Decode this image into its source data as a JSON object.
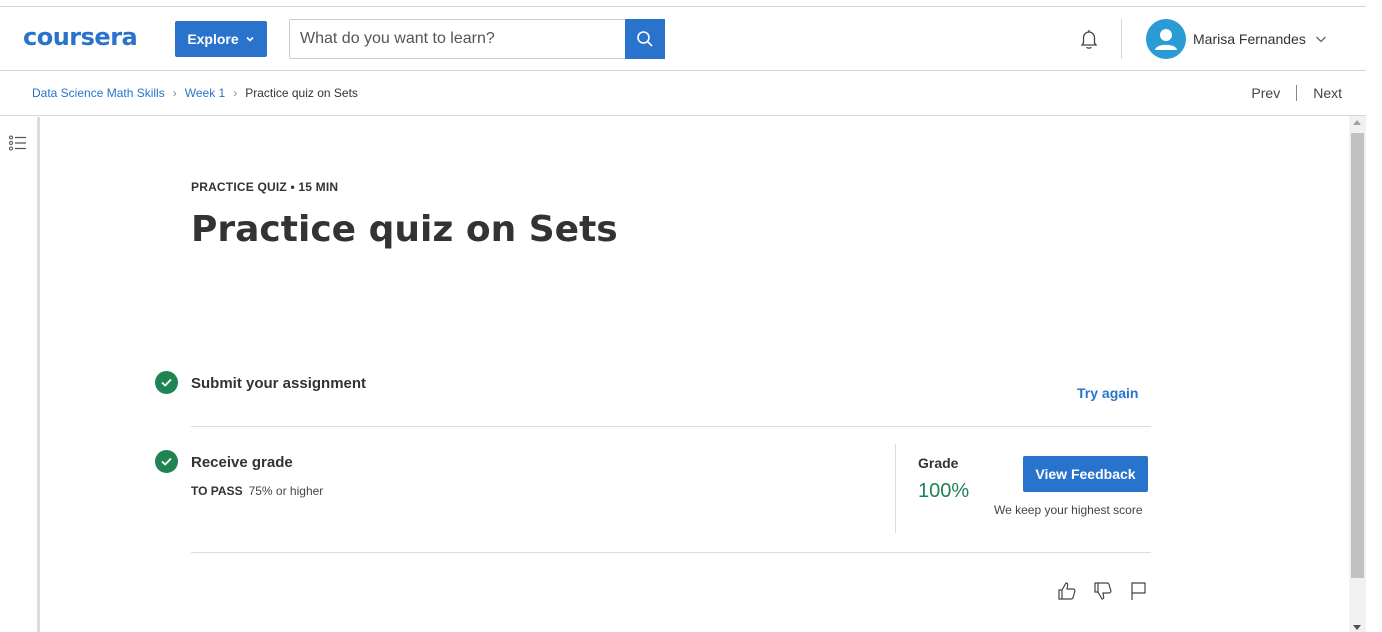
{
  "header": {
    "logo": "coursera",
    "explore_label": "Explore",
    "search_placeholder": "What do you want to learn?",
    "user_name": "Marisa Fernandes",
    "icons": [
      "search-icon",
      "bell-icon",
      "avatar-icon",
      "chevron-down-icon"
    ]
  },
  "breadcrumb": {
    "items": [
      "Data Science Math Skills",
      "Week 1",
      "Practice quiz on Sets"
    ],
    "prev": "Prev",
    "next": "Next"
  },
  "quiz": {
    "kicker": "PRACTICE QUIZ • 15 MIN",
    "title": "Practice quiz on Sets",
    "step1_title": "Submit your assignment",
    "try_again": "Try again",
    "step2_title": "Receive grade",
    "to_pass_label": "TO PASS",
    "to_pass_value": "75% or higher",
    "grade_label": "Grade",
    "grade_value": "100%",
    "view_feedback": "View Feedback",
    "keep_note": "We keep your highest score"
  },
  "colors": {
    "accent": "#2a73cc",
    "success": "#1f8354"
  }
}
